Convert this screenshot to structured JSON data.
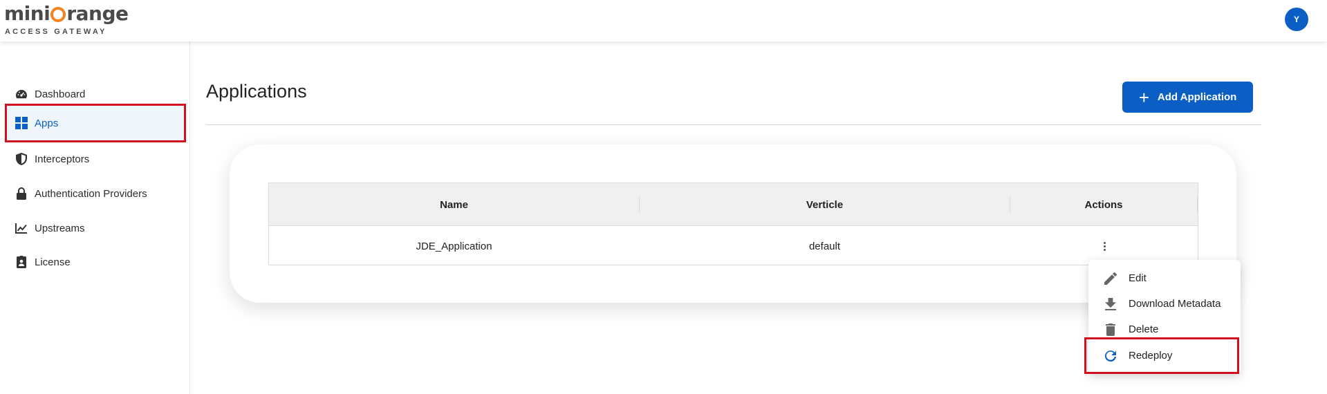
{
  "header": {
    "logo_text": "miniOrange",
    "logo_subtitle": "ACCESS GATEWAY",
    "avatar_initial": "Y"
  },
  "sidebar": {
    "items": [
      {
        "label": "Dashboard",
        "icon": "dashboard-gauge-icon"
      },
      {
        "label": "Apps",
        "icon": "apps-grid-icon",
        "active": true
      },
      {
        "label": "Interceptors",
        "icon": "shield-icon"
      },
      {
        "label": "Authentication Providers",
        "icon": "lock-icon"
      },
      {
        "label": "Upstreams",
        "icon": "trending-chart-icon"
      },
      {
        "label": "License",
        "icon": "badge-icon"
      }
    ]
  },
  "main": {
    "title": "Applications",
    "add_button_label": "Add Application",
    "table": {
      "columns": [
        "Name",
        "Verticle",
        "Actions"
      ],
      "rows": [
        {
          "name": "JDE_Application",
          "verticle": "default"
        }
      ]
    },
    "actions_menu": {
      "items": [
        {
          "label": "Edit",
          "icon": "pencil-icon"
        },
        {
          "label": "Download Metadata",
          "icon": "download-icon"
        },
        {
          "label": "Delete",
          "icon": "trash-icon"
        },
        {
          "label": "Redeploy",
          "icon": "refresh-icon"
        }
      ]
    }
  },
  "colors": {
    "primary": "#0b5ec4",
    "logo_accent": "#f58220",
    "highlight_box": "#d0101e",
    "active_bg": "#eef6fc"
  }
}
